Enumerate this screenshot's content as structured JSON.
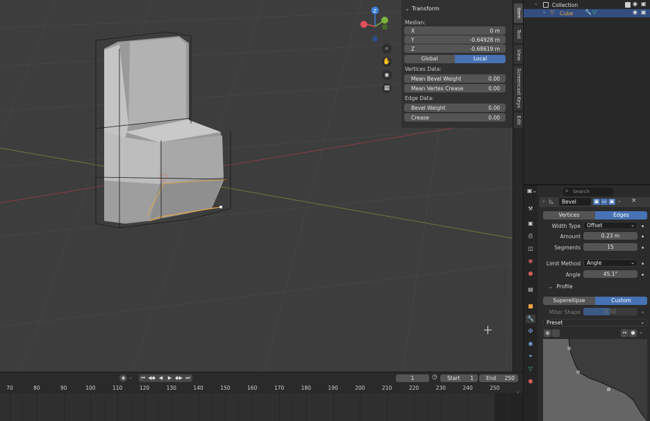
{
  "viewport": {
    "gizmo": {
      "z_label": "Z",
      "colors": {
        "x": "#e54e5e",
        "y": "#7bb33b",
        "z": "#3c7fd6"
      }
    },
    "tools": [
      "zoom-icon",
      "hand-pan-icon",
      "camera-icon",
      "grid-icon"
    ]
  },
  "npanel": {
    "title": "Transform",
    "median_label": "Median:",
    "x_label": "X",
    "x_value": "0 m",
    "y_label": "Y",
    "y_value": "-0.64928 m",
    "z_label": "Z",
    "z_value": "-0.68619 m",
    "global_label": "Global",
    "local_label": "Local",
    "vertices_data_label": "Vertices Data:",
    "mean_bevel_weight_label": "Mean Bevel Weight",
    "mean_bevel_weight_value": "0.00",
    "mean_vertex_crease_label": "Mean Vertex Crease",
    "mean_vertex_crease_value": "0.00",
    "edge_data_label": "Edge Data:",
    "bevel_weight_label": "Bevel Weight",
    "bevel_weight_value": "0.00",
    "crease_label": "Crease",
    "crease_value": "0.00"
  },
  "vtabs": [
    "Item",
    "Tool",
    "View",
    "Screencast Keys",
    "Edit"
  ],
  "outliner": {
    "collection_label": "Collection",
    "cube_label": "Cube",
    "cube_color": "#e8a545"
  },
  "properties": {
    "search_placeholder": "Search",
    "modifier_name": "Bevel",
    "vertices_label": "Vertices",
    "edges_label": "Edges",
    "width_type_label": "Width Type",
    "width_type_value": "Offset",
    "amount_label": "Amount",
    "amount_value": "0.23 m",
    "segments_label": "Segments",
    "segments_value": "15",
    "limit_method_label": "Limit Method",
    "limit_method_value": "Angle",
    "angle_label": "Angle",
    "angle_value": "45.1°",
    "profile_label": "Profile",
    "superellipse_label": "Superellipse",
    "custom_label": "Custom",
    "miter_shape_label": "Miter Shape",
    "miter_shape_value": "0.50",
    "preset_label": "Preset"
  },
  "timeline": {
    "frame_numbers": [
      "70",
      "80",
      "90",
      "100",
      "110",
      "120",
      "130",
      "140",
      "150",
      "160",
      "170",
      "180",
      "190",
      "200",
      "210",
      "220",
      "230",
      "240",
      "250"
    ],
    "current_frame": "1",
    "start_label": "Start",
    "start_value": "1",
    "end_label": "End",
    "end_value": "250"
  }
}
